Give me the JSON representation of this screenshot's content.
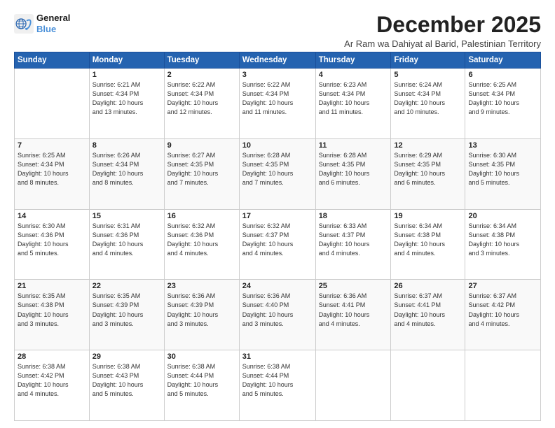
{
  "logo": {
    "line1": "General",
    "line2": "Blue"
  },
  "title": "December 2025",
  "subtitle": "Ar Ram wa Dahiyat al Barid, Palestinian Territory",
  "days_header": [
    "Sunday",
    "Monday",
    "Tuesday",
    "Wednesday",
    "Thursday",
    "Friday",
    "Saturday"
  ],
  "weeks": [
    [
      {
        "day": "",
        "info": ""
      },
      {
        "day": "1",
        "info": "Sunrise: 6:21 AM\nSunset: 4:34 PM\nDaylight: 10 hours\nand 13 minutes."
      },
      {
        "day": "2",
        "info": "Sunrise: 6:22 AM\nSunset: 4:34 PM\nDaylight: 10 hours\nand 12 minutes."
      },
      {
        "day": "3",
        "info": "Sunrise: 6:22 AM\nSunset: 4:34 PM\nDaylight: 10 hours\nand 11 minutes."
      },
      {
        "day": "4",
        "info": "Sunrise: 6:23 AM\nSunset: 4:34 PM\nDaylight: 10 hours\nand 11 minutes."
      },
      {
        "day": "5",
        "info": "Sunrise: 6:24 AM\nSunset: 4:34 PM\nDaylight: 10 hours\nand 10 minutes."
      },
      {
        "day": "6",
        "info": "Sunrise: 6:25 AM\nSunset: 4:34 PM\nDaylight: 10 hours\nand 9 minutes."
      }
    ],
    [
      {
        "day": "7",
        "info": "Sunrise: 6:25 AM\nSunset: 4:34 PM\nDaylight: 10 hours\nand 8 minutes."
      },
      {
        "day": "8",
        "info": "Sunrise: 6:26 AM\nSunset: 4:34 PM\nDaylight: 10 hours\nand 8 minutes."
      },
      {
        "day": "9",
        "info": "Sunrise: 6:27 AM\nSunset: 4:35 PM\nDaylight: 10 hours\nand 7 minutes."
      },
      {
        "day": "10",
        "info": "Sunrise: 6:28 AM\nSunset: 4:35 PM\nDaylight: 10 hours\nand 7 minutes."
      },
      {
        "day": "11",
        "info": "Sunrise: 6:28 AM\nSunset: 4:35 PM\nDaylight: 10 hours\nand 6 minutes."
      },
      {
        "day": "12",
        "info": "Sunrise: 6:29 AM\nSunset: 4:35 PM\nDaylight: 10 hours\nand 6 minutes."
      },
      {
        "day": "13",
        "info": "Sunrise: 6:30 AM\nSunset: 4:35 PM\nDaylight: 10 hours\nand 5 minutes."
      }
    ],
    [
      {
        "day": "14",
        "info": "Sunrise: 6:30 AM\nSunset: 4:36 PM\nDaylight: 10 hours\nand 5 minutes."
      },
      {
        "day": "15",
        "info": "Sunrise: 6:31 AM\nSunset: 4:36 PM\nDaylight: 10 hours\nand 4 minutes."
      },
      {
        "day": "16",
        "info": "Sunrise: 6:32 AM\nSunset: 4:36 PM\nDaylight: 10 hours\nand 4 minutes."
      },
      {
        "day": "17",
        "info": "Sunrise: 6:32 AM\nSunset: 4:37 PM\nDaylight: 10 hours\nand 4 minutes."
      },
      {
        "day": "18",
        "info": "Sunrise: 6:33 AM\nSunset: 4:37 PM\nDaylight: 10 hours\nand 4 minutes."
      },
      {
        "day": "19",
        "info": "Sunrise: 6:34 AM\nSunset: 4:38 PM\nDaylight: 10 hours\nand 4 minutes."
      },
      {
        "day": "20",
        "info": "Sunrise: 6:34 AM\nSunset: 4:38 PM\nDaylight: 10 hours\nand 3 minutes."
      }
    ],
    [
      {
        "day": "21",
        "info": "Sunrise: 6:35 AM\nSunset: 4:38 PM\nDaylight: 10 hours\nand 3 minutes."
      },
      {
        "day": "22",
        "info": "Sunrise: 6:35 AM\nSunset: 4:39 PM\nDaylight: 10 hours\nand 3 minutes."
      },
      {
        "day": "23",
        "info": "Sunrise: 6:36 AM\nSunset: 4:39 PM\nDaylight: 10 hours\nand 3 minutes."
      },
      {
        "day": "24",
        "info": "Sunrise: 6:36 AM\nSunset: 4:40 PM\nDaylight: 10 hours\nand 3 minutes."
      },
      {
        "day": "25",
        "info": "Sunrise: 6:36 AM\nSunset: 4:41 PM\nDaylight: 10 hours\nand 4 minutes."
      },
      {
        "day": "26",
        "info": "Sunrise: 6:37 AM\nSunset: 4:41 PM\nDaylight: 10 hours\nand 4 minutes."
      },
      {
        "day": "27",
        "info": "Sunrise: 6:37 AM\nSunset: 4:42 PM\nDaylight: 10 hours\nand 4 minutes."
      }
    ],
    [
      {
        "day": "28",
        "info": "Sunrise: 6:38 AM\nSunset: 4:42 PM\nDaylight: 10 hours\nand 4 minutes."
      },
      {
        "day": "29",
        "info": "Sunrise: 6:38 AM\nSunset: 4:43 PM\nDaylight: 10 hours\nand 5 minutes."
      },
      {
        "day": "30",
        "info": "Sunrise: 6:38 AM\nSunset: 4:44 PM\nDaylight: 10 hours\nand 5 minutes."
      },
      {
        "day": "31",
        "info": "Sunrise: 6:38 AM\nSunset: 4:44 PM\nDaylight: 10 hours\nand 5 minutes."
      },
      {
        "day": "",
        "info": ""
      },
      {
        "day": "",
        "info": ""
      },
      {
        "day": "",
        "info": ""
      }
    ]
  ]
}
